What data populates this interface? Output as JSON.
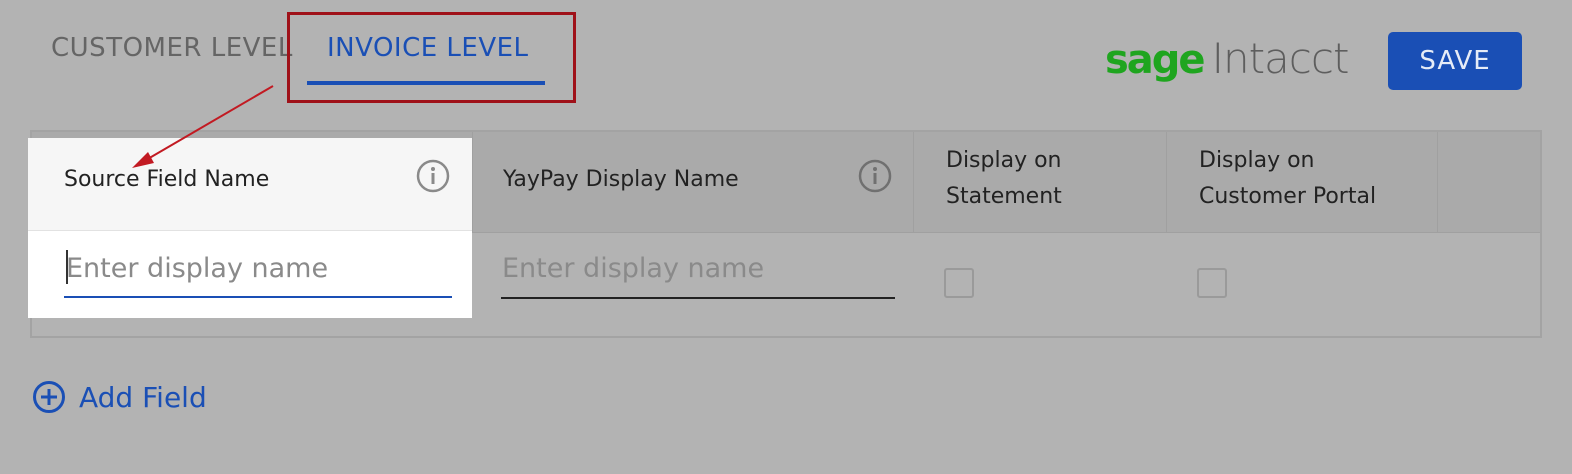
{
  "tabs": [
    {
      "label": "CUSTOMER LEVEL",
      "active": false
    },
    {
      "label": "INVOICE LEVEL",
      "active": true
    }
  ],
  "brand": {
    "sage": "sage",
    "intacct": "Intacct",
    "sage_color": "#1fa51f",
    "intacct_color": "#5e5e5e"
  },
  "toolbar": {
    "save_label": "SAVE"
  },
  "table": {
    "columns": [
      {
        "label": "Source Field Name",
        "has_info": true
      },
      {
        "label": "YayPay Display Name",
        "has_info": true
      },
      {
        "label_line1": "Display on",
        "label_line2": "Statement"
      },
      {
        "label_line1": "Display on",
        "label_line2": "Customer Portal"
      }
    ],
    "row": {
      "source_placeholder": "Enter display name",
      "display_placeholder": "Enter display name",
      "statement_checked": false,
      "portal_checked": false
    }
  },
  "actions": {
    "add_field_label": "Add Field"
  },
  "colors": {
    "accent": "#1a4fb5",
    "highlight": "#9f1119",
    "overlay": "#b3b3b3"
  },
  "icons": [
    "info-icon",
    "plus-circle-icon",
    "arrow-annotation"
  ]
}
